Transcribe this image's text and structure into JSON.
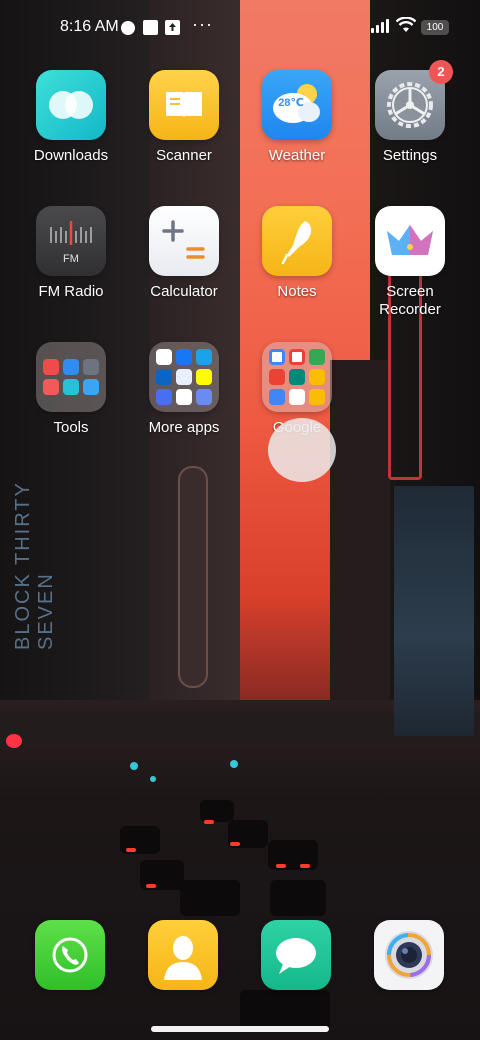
{
  "status_bar": {
    "time": "8:16 AM",
    "more": "···",
    "battery": "100"
  },
  "apps": [
    {
      "label": "Downloads",
      "icon": "downloads-icon"
    },
    {
      "label": "Scanner",
      "icon": "scanner-icon"
    },
    {
      "label": "Weather",
      "icon": "weather-icon",
      "temperature": "28℃"
    },
    {
      "label": "Settings",
      "icon": "settings-icon",
      "badge": "2"
    },
    {
      "label": "FM Radio",
      "icon": "fm-radio-icon",
      "icon_text": "FM"
    },
    {
      "label": "Calculator",
      "icon": "calculator-icon"
    },
    {
      "label": "Notes",
      "icon": "notes-icon"
    },
    {
      "label": "Screen\nRecorder",
      "icon": "screen-recorder-icon"
    },
    {
      "label": "Tools",
      "icon": "tools-folder-icon"
    },
    {
      "label": "More apps",
      "icon": "more-apps-folder-icon"
    },
    {
      "label": "Google",
      "icon": "google-folder-icon"
    }
  ],
  "dock": [
    {
      "name": "phone",
      "icon": "phone-icon"
    },
    {
      "name": "contacts",
      "icon": "contacts-icon"
    },
    {
      "name": "messages",
      "icon": "messages-icon"
    },
    {
      "name": "camera",
      "icon": "camera-icon"
    }
  ],
  "colors": {
    "badge": "#f05555",
    "sky": "#f26f55"
  }
}
